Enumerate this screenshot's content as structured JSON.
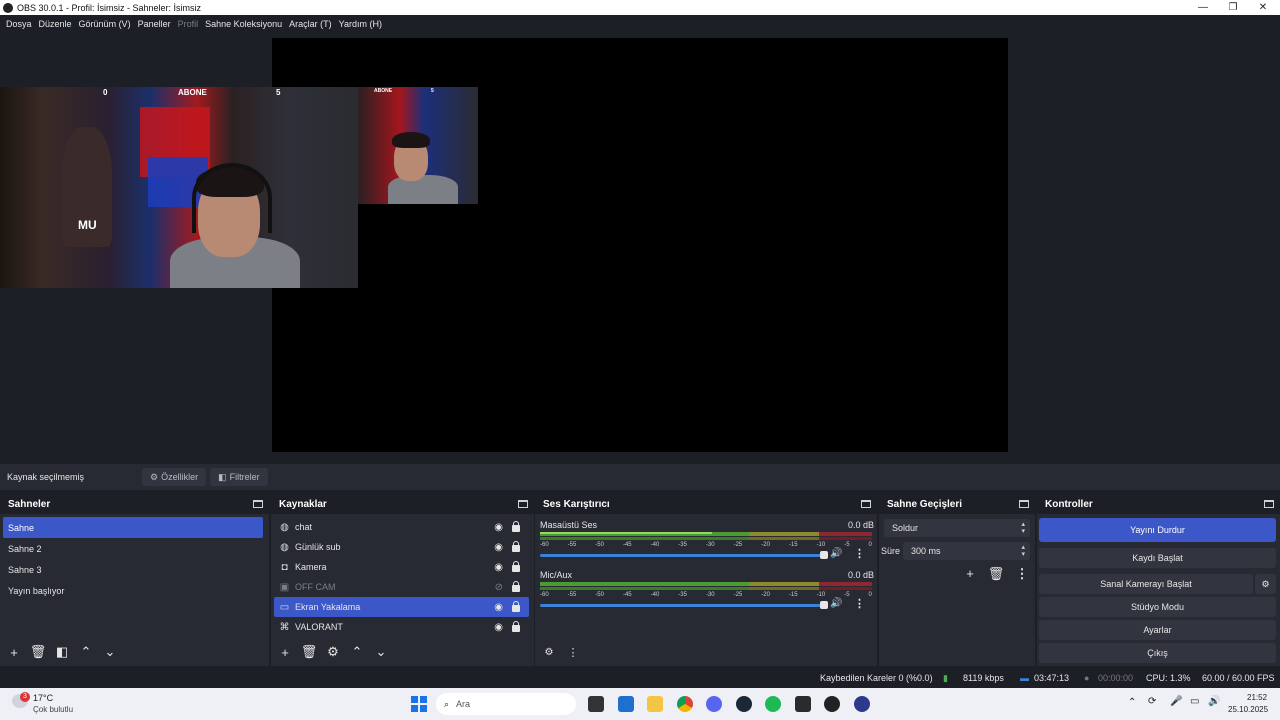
{
  "window": {
    "title": "OBS 30.0.1 - Profil: İsimsiz - Sahneler: İsimsiz",
    "minimize": "—",
    "maximize": "❐",
    "close": "✕"
  },
  "menu": [
    "Dosya",
    "Düzenle",
    "Görünüm (V)",
    "Paneller",
    "Profil",
    "Sahne Koleksiyonu",
    "Araçlar (T)",
    "Yardım (H)"
  ],
  "preview": {
    "overlay_left": "0",
    "overlay_center": "ABONE",
    "overlay_right": "5",
    "small_center": "ABONE",
    "small_right": "5",
    "cam_text": "MU"
  },
  "context_bar": {
    "label": "Kaynak seçilmemiş",
    "properties": "Özellikler",
    "filters": "Filtreler"
  },
  "docks": {
    "scenes": "Sahneler",
    "sources": "Kaynaklar",
    "mixer": "Ses Karıştırıcı",
    "transitions": "Sahne Geçişleri",
    "controls": "Kontroller"
  },
  "scenes": [
    "Sahne",
    "Sahne 2",
    "Sahne 3",
    "Yayın başlıyor"
  ],
  "sources": [
    {
      "name": "chat",
      "icon": "browser-icon"
    },
    {
      "name": "Günlük sub",
      "icon": "browser-icon"
    },
    {
      "name": "Kamera",
      "icon": "camera-icon"
    },
    {
      "name": "OFF CAM",
      "icon": "image-icon"
    },
    {
      "name": "Ekran Yakalama",
      "icon": "monitor-icon"
    },
    {
      "name": "VALORANT",
      "icon": "gamepad-icon"
    }
  ],
  "mixer": {
    "channels": [
      {
        "name": "Masaüstü Ses",
        "db": "0.0 dB"
      },
      {
        "name": "Mic/Aux",
        "db": "0.0 dB"
      }
    ],
    "ticks": [
      "-60",
      "-55",
      "-50",
      "-45",
      "-40",
      "-35",
      "-30",
      "-25",
      "-20",
      "-15",
      "-10",
      "-5",
      "0"
    ]
  },
  "transitions": {
    "type": "Soldur",
    "duration_label": "Süre",
    "duration": "300 ms"
  },
  "controls": {
    "stream": "Yayını Durdur",
    "record": "Kaydı Başlat",
    "virtual_cam": "Sanal Kamerayı Başlat",
    "studio": "Stüdyo Modu",
    "settings": "Ayarlar",
    "exit": "Çıkış"
  },
  "status": {
    "dropped": "Kaybedilen Kareler 0 (%0.0)",
    "bitrate": "8119 kbps",
    "stream_time": "03:47:13",
    "rec_time": "00:00:00",
    "cpu": "CPU: 1.3%",
    "fps": "60.00 / 60.00 FPS"
  },
  "taskbar": {
    "weather_temp": "17°C",
    "weather_desc": "Çok bulutlu",
    "weather_badge": "3",
    "search": "Ara",
    "time": "21:52",
    "date": "25.10.2025"
  },
  "colors": {
    "accent": "#3c57c7",
    "panel": "#272a33",
    "background": "#1d1f26"
  }
}
